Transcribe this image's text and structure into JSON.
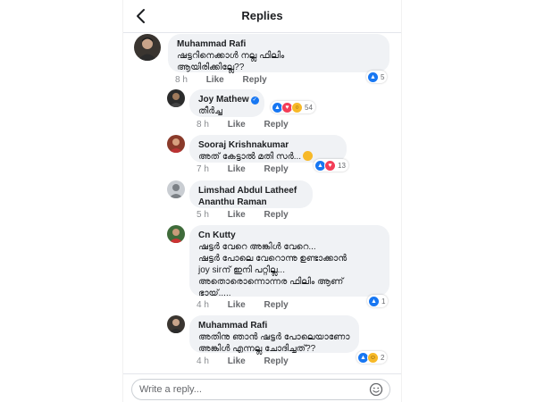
{
  "header": {
    "title": "Replies"
  },
  "comments": [
    {
      "author": "Muhammad Rafi",
      "lines": [
        "ഷട്ടറിനെക്കാൾ നല്ല ഫിലിം",
        "ആയിരിക്കില്ലേ??"
      ],
      "time": "8 h",
      "like_label": "Like",
      "reply_label": "Reply",
      "reactions": {
        "icons": [
          "like"
        ],
        "count": "5"
      }
    },
    {
      "author": "Joy Mathew",
      "verified": true,
      "lines": [
        "തീർച്ച"
      ],
      "time": "8 h",
      "like_label": "Like",
      "reply_label": "Reply",
      "reactions": {
        "icons": [
          "like",
          "love",
          "wow"
        ],
        "count": "54"
      }
    },
    {
      "author": "Sooraj Krishnakumar",
      "lines": [
        "അത് കേട്ടാൽ മതി സർ..."
      ],
      "time": "7 h",
      "like_label": "Like",
      "reply_label": "Reply",
      "reactions": {
        "icons": [
          "like",
          "love"
        ],
        "count": "13"
      }
    },
    {
      "author": "Limshad Abdul Latheef",
      "lines": [
        "Ananthu Raman"
      ],
      "time": "5 h",
      "like_label": "Like",
      "reply_label": "Reply"
    },
    {
      "author": "Cn Kutty",
      "lines": [
        "ഷട്ടർ വേറെ അങ്കിൾ വേറെ...",
        "ഷട്ടർ പോലെ വേറൊന്നു ഉണ്ടാക്കാൻ",
        "joy sirന് ഇനി പറ്റില്ല...",
        "അതൊരൊന്നൊന്നര ഫിലിം ആണ്",
        "ഭായ്....."
      ],
      "time": "4 h",
      "like_label": "Like",
      "reply_label": "Reply",
      "reactions": {
        "icons": [
          "like"
        ],
        "count": "1"
      }
    },
    {
      "author": "Muhammad Rafi",
      "lines": [
        "അതിനു ഞാൻ ഷട്ടർ പോലെയാണോ",
        "അങ്കിൾ എന്നല്ല ചോദിച്ചത്??"
      ],
      "time": "4 h",
      "like_label": "Like",
      "reply_label": "Reply",
      "reactions": {
        "icons": [
          "like",
          "haha"
        ],
        "count": "2"
      }
    }
  ],
  "footer": {
    "placeholder": "Write a reply..."
  },
  "colors": {
    "accent": "#1877f2",
    "bubble": "#f0f2f5",
    "love": "#f33e58",
    "wow": "#f7b928"
  }
}
